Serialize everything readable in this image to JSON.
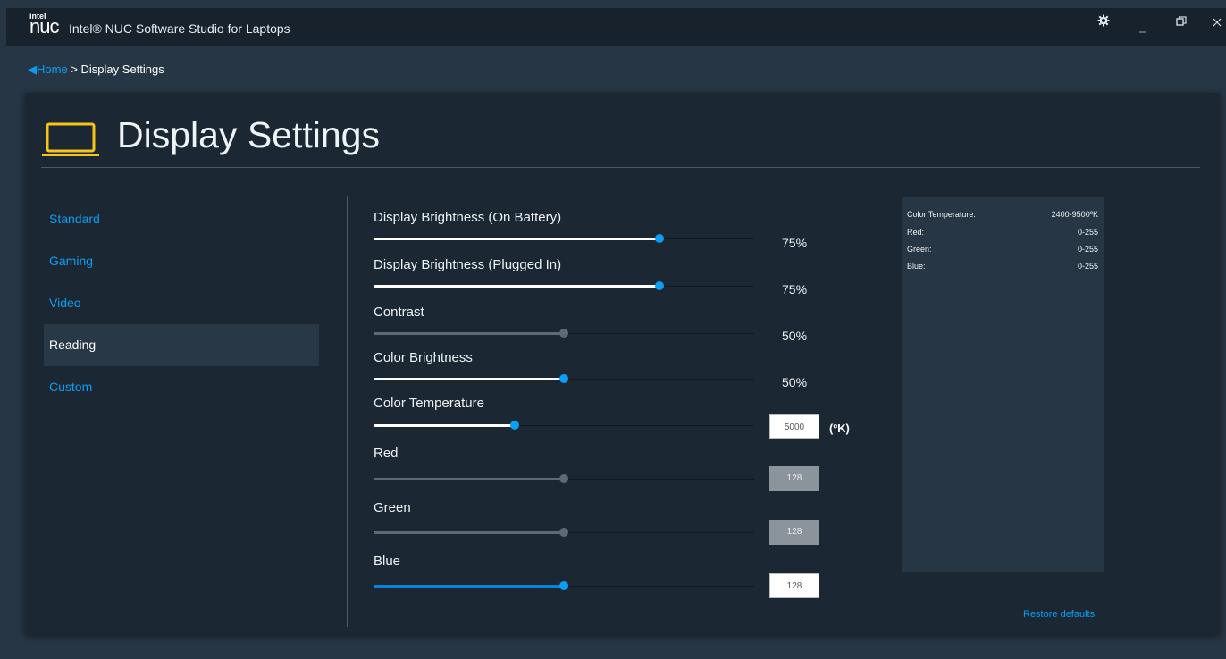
{
  "app": {
    "logo_top": "intel",
    "logo_main": "nuc",
    "title": "Intel® NUC Software Studio for Laptops"
  },
  "titlebar_icons": {
    "settings": "gear-icon",
    "minimize": "minimize-icon",
    "restore": "restore-icon",
    "close": "close-icon"
  },
  "breadcrumb": {
    "back_icon": "◀",
    "home": "Home",
    "separator": ">",
    "current": "Display Settings"
  },
  "page": {
    "title": "Display Settings",
    "icon": "laptop-icon",
    "icon_color": "#f5c518"
  },
  "sidebar": {
    "items": [
      {
        "label": "Standard",
        "selected": false
      },
      {
        "label": "Gaming",
        "selected": false
      },
      {
        "label": "Video",
        "selected": false
      },
      {
        "label": "Reading",
        "selected": true
      },
      {
        "label": "Custom",
        "selected": false
      }
    ]
  },
  "sliders": [
    {
      "label": "Display Brightness (On Battery)",
      "value_pct": 75,
      "display": "75%",
      "enabled": true
    },
    {
      "label": "Display Brightness (Plugged In)",
      "value_pct": 75,
      "display": "75%",
      "enabled": true
    },
    {
      "label": "Contrast",
      "value_pct": 50,
      "display": "50%",
      "enabled": false
    },
    {
      "label": "Color Brightness",
      "value_pct": 50,
      "display": "50%",
      "enabled": true
    },
    {
      "label": "Color Temperature",
      "value_pct": 37,
      "display": "5000",
      "enabled": true
    },
    {
      "label": "Red",
      "value_pct": 50,
      "display": "128",
      "enabled": false
    },
    {
      "label": "Green",
      "value_pct": 50,
      "display": "128",
      "enabled": false
    },
    {
      "label": "Blue",
      "value_pct": 50,
      "display": "128",
      "enabled": true
    }
  ],
  "color_temp_unit": "(ºK)",
  "info": {
    "rows": [
      {
        "label": "Color Temperature:",
        "value": "2400-9500ºK"
      },
      {
        "label": "Red:",
        "value": "0-255"
      },
      {
        "label": "Green:",
        "value": "0-255"
      },
      {
        "label": "Blue:",
        "value": "0-255"
      }
    ]
  },
  "restore_label": "Restore defaults",
  "colors": {
    "accent": "#0b9ef5",
    "active_fill": "#ffffff",
    "blue_fill": "#0a84d8",
    "disabled": "#5c6a77"
  }
}
